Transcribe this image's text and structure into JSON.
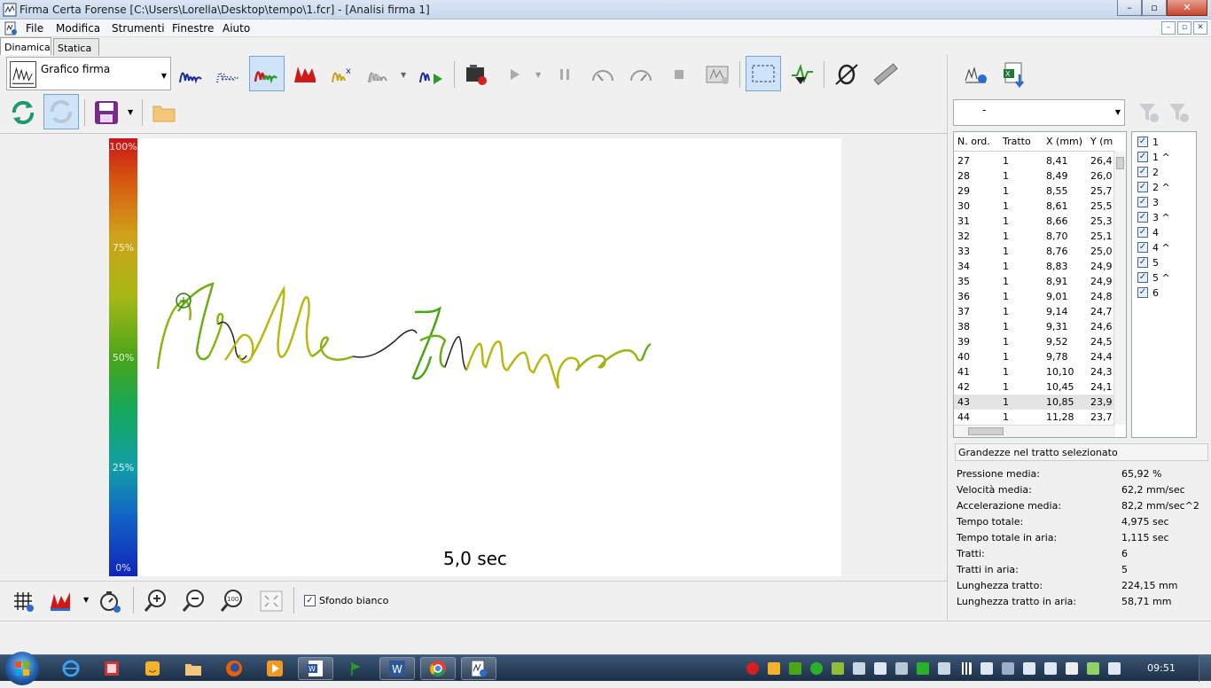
{
  "window": {
    "title": "Firma Certa Forense [C:\\Users\\Lorella\\Desktop\\tempo\\1.fcr] - [Analisi firma 1]",
    "minimize": "–",
    "maximize": "▫",
    "close": "✕"
  },
  "menu": [
    "File",
    "Modifica",
    "Strumenti",
    "Finestre",
    "Aiuto"
  ],
  "mdi": [
    "–",
    "▫",
    "✕"
  ],
  "tabs": [
    "Dinamica",
    "Statica"
  ],
  "toolbar": {
    "chart_combo": "Grafico firma"
  },
  "canvas": {
    "scale_labels": [
      "100%",
      "75%",
      "50%",
      "25%",
      "0%"
    ],
    "time_label": "5,0 sec"
  },
  "bottom": {
    "white_bg_label": "Sfondo bianco",
    "white_bg_checked": "✓"
  },
  "right": {
    "filter_combo": "-",
    "columns": [
      "N. ord.",
      "Tratto",
      "X (mm)",
      "Y (m"
    ],
    "rows": [
      [
        "27",
        "1",
        "8,41",
        "26,4"
      ],
      [
        "28",
        "1",
        "8,49",
        "26,0"
      ],
      [
        "29",
        "1",
        "8,55",
        "25,7"
      ],
      [
        "30",
        "1",
        "8,61",
        "25,5"
      ],
      [
        "31",
        "1",
        "8,66",
        "25,3"
      ],
      [
        "32",
        "1",
        "8,70",
        "25,1"
      ],
      [
        "33",
        "1",
        "8,76",
        "25,0"
      ],
      [
        "34",
        "1",
        "8,83",
        "24,9"
      ],
      [
        "35",
        "1",
        "8,91",
        "24,9"
      ],
      [
        "36",
        "1",
        "9,01",
        "24,8"
      ],
      [
        "37",
        "1",
        "9,14",
        "24,7"
      ],
      [
        "38",
        "1",
        "9,31",
        "24,6"
      ],
      [
        "39",
        "1",
        "9,52",
        "24,5"
      ],
      [
        "40",
        "1",
        "9,78",
        "24,4"
      ],
      [
        "41",
        "1",
        "10,10",
        "24,3"
      ],
      [
        "42",
        "1",
        "10,45",
        "24,1"
      ],
      [
        "43",
        "1",
        "10,85",
        "23,9"
      ],
      [
        "44",
        "1",
        "11,28",
        "23,7"
      ]
    ],
    "selected_row": "43",
    "strokes": [
      "1",
      "1 ^",
      "2",
      "2 ^",
      "3",
      "3 ^",
      "4",
      "4 ^",
      "5",
      "5 ^",
      "6"
    ],
    "stats_header": "Grandezze nel tratto selezionato",
    "stats": [
      {
        "label": "Pressione media:",
        "value": "65,92 %"
      },
      {
        "label": "Velocità media:",
        "value": "62,2 mm/sec"
      },
      {
        "label": "Accelerazione media:",
        "value": "82,2 mm/sec^2"
      },
      {
        "label": "Tempo totale:",
        "value": "4,975 sec"
      },
      {
        "label": "Tempo totale in aria:",
        "value": "1,115 sec"
      },
      {
        "label": "Tratti:",
        "value": "6"
      },
      {
        "label": "Tratti in aria:",
        "value": "5"
      },
      {
        "label": "Lunghezza tratto:",
        "value": "224,15 mm"
      },
      {
        "label": "Lunghezza tratto in aria:",
        "value": "58,71 mm"
      }
    ]
  },
  "taskbar": {
    "clock": "09:51"
  },
  "colors": {
    "ink_high": "#8bb617",
    "ink_mid": "#b8b812",
    "ink_low": "#3fa31e",
    "air_stroke": "#222222",
    "selection_blue": "#cfe4f8"
  }
}
